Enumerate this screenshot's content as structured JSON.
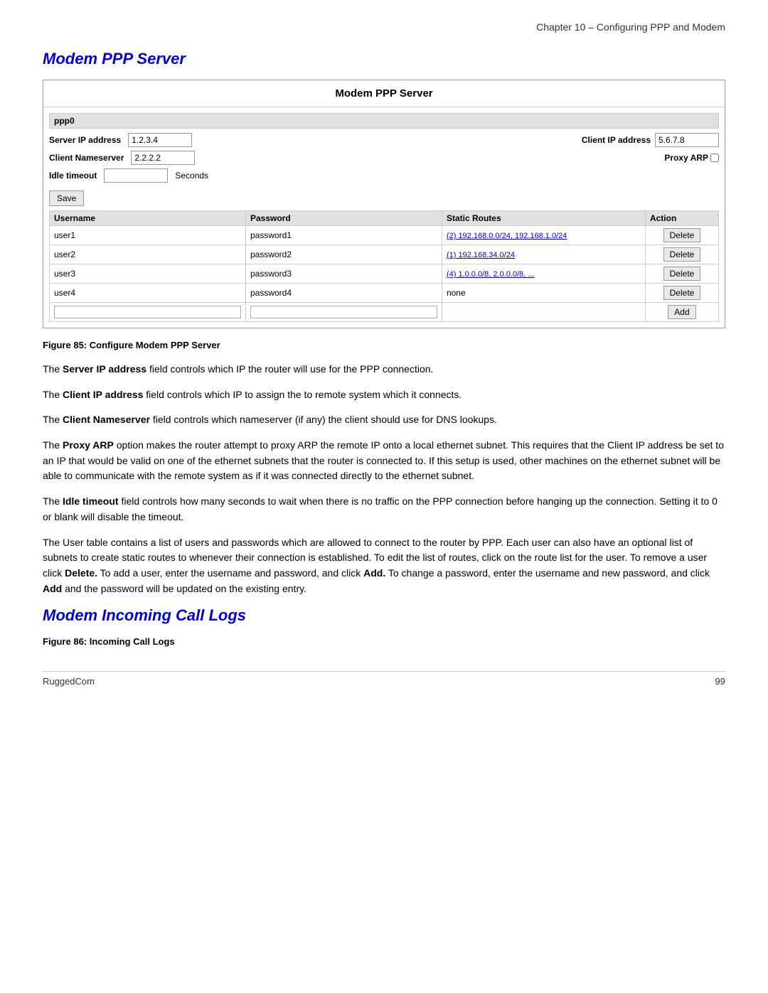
{
  "page": {
    "header": "Chapter 10 – Configuring PPP and Modem",
    "footer_left": "RuggedCom",
    "footer_right": "99"
  },
  "modem_ppp_section": {
    "heading": "Modem PPP Server",
    "panel_title": "Modem PPP Server",
    "ppp0_label": "ppp0",
    "fields": {
      "server_ip_label": "Server IP address",
      "server_ip_value": "1.2.3.4",
      "client_ip_label": "Client IP address",
      "client_ip_value": "5.6.7.8",
      "client_ns_label": "Client Nameserver",
      "client_ns_value": "2.2.2.2",
      "proxy_arp_label": "Proxy ARP",
      "idle_timeout_label": "Idle timeout",
      "idle_timeout_value": "",
      "seconds_label": "Seconds"
    },
    "save_button": "Save",
    "table": {
      "columns": [
        "Username",
        "Password",
        "Static Routes",
        "Action"
      ],
      "rows": [
        {
          "username": "user1",
          "password": "password1",
          "routes": "(2) 192.168.0.0/24, 192.168.1.0/24",
          "action": "Delete"
        },
        {
          "username": "user2",
          "password": "password2",
          "routes": "(1) 192.168.34.0/24",
          "action": "Delete"
        },
        {
          "username": "user3",
          "password": "password3",
          "routes": "(4) 1.0.0.0/8, 2.0.0.0/8, ...",
          "action": "Delete"
        },
        {
          "username": "user4",
          "password": "password4",
          "routes": "none",
          "action": "Delete"
        }
      ],
      "add_button": "Add"
    },
    "figure_caption": "Figure 85: Configure Modem PPP Server"
  },
  "body_paragraphs": [
    {
      "id": "p1",
      "bold_intro": "Server IP address",
      "text": " field controls which IP the router will use for the PPP connection."
    },
    {
      "id": "p2",
      "bold_intro": "Client IP address",
      "text": " field controls which IP to assign the to remote system which it connects."
    },
    {
      "id": "p3",
      "bold_intro": "Client Nameserver",
      "text": " field controls which nameserver (if any) the client should use for DNS lookups."
    },
    {
      "id": "p4",
      "bold_intro": "Proxy ARP",
      "text": " option makes the router attempt to proxy ARP the remote IP onto a local ethernet subnet.  This requires that the Client IP address be set to an IP that would be valid on one of the ethernet subnets that the router is connected to.  If this setup is used, other machines on the ethernet subnet will be able to communicate with the remote system as if it was connected directly to the ethernet subnet."
    },
    {
      "id": "p5",
      "bold_intro": "Idle timeout",
      "text": " field controls how many seconds to wait when there is no traffic on the PPP connection before hanging up the connection.  Setting it to 0 or blank will disable the timeout."
    },
    {
      "id": "p6",
      "bold_intro": "",
      "text": "The User table contains a list of users and passwords which are allowed to connect to the router by PPP.  Each user can also have an optional list of subnets to create static routes to whenever their connection is established.  To edit the list of routes, click on the route list for the user.  To remove a user click Delete. To add a user, enter the username and password, and click Add.  To change a password, enter the username and new password, and click Add and the password will be updated on the existing entry."
    }
  ],
  "modem_incoming_section": {
    "heading": "Modem Incoming Call Logs",
    "figure_caption": "Figure 86: Incoming Call Logs"
  }
}
